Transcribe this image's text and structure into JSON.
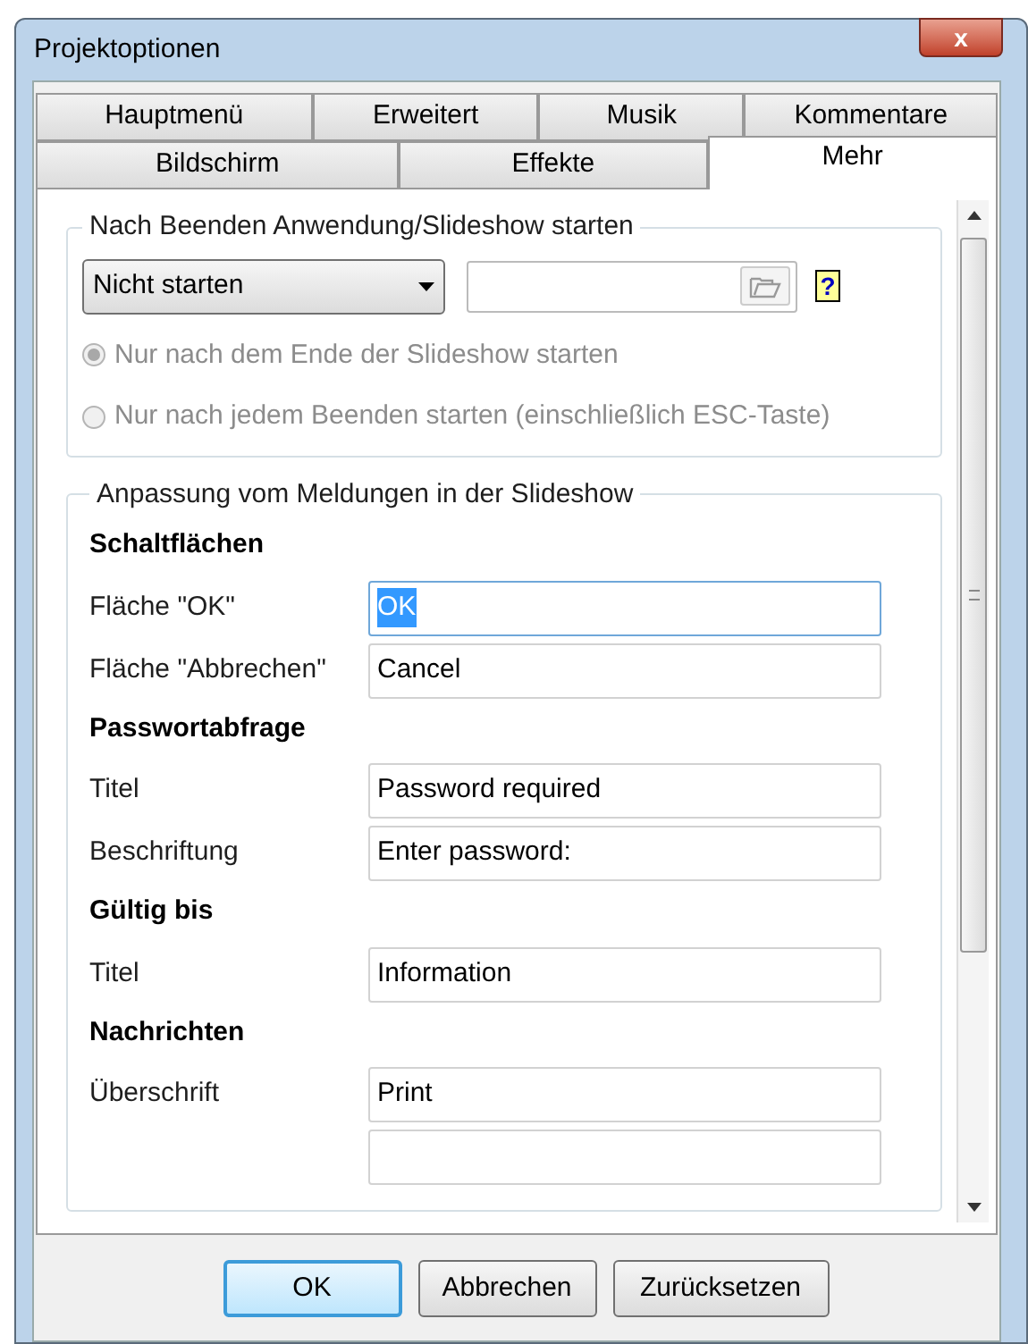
{
  "window": {
    "title": "Projektoptionen",
    "close_glyph": "x"
  },
  "tab_rows": [
    [
      {
        "label": "Hauptmenü",
        "selected": false
      },
      {
        "label": "Erweitert",
        "selected": false
      },
      {
        "label": "Musik",
        "selected": false
      },
      {
        "label": "Kommentare",
        "selected": false
      }
    ],
    [
      {
        "label": "Bildschirm",
        "selected": false
      },
      {
        "label": "Effekte",
        "selected": false
      },
      {
        "label": "Mehr",
        "selected": true
      }
    ]
  ],
  "start_group": {
    "title": "Nach Beenden Anwendung/Slideshow starten",
    "dropdown": {
      "value": "Nicht starten"
    },
    "help_glyph": "?",
    "radios": [
      {
        "label": "Nur nach dem Ende der Slideshow starten",
        "selected": true,
        "disabled": true
      },
      {
        "label": "Nur nach jedem Beenden starten (einschließlich ESC-Taste)",
        "selected": false,
        "disabled": true
      }
    ]
  },
  "messages_group": {
    "title": "Anpassung vom Meldungen in der Slideshow",
    "sections": [
      {
        "heading": "Schaltflächen",
        "fields": [
          {
            "label": "Fläche \"OK\"",
            "value": "OK",
            "focused": true
          },
          {
            "label": "Fläche \"Abbrechen\"",
            "value": "Cancel",
            "focused": false
          }
        ]
      },
      {
        "heading": "Passwortabfrage",
        "fields": [
          {
            "label": "Titel",
            "value": "Password required",
            "focused": false
          },
          {
            "label": "Beschriftung",
            "value": "Enter password:",
            "focused": false
          }
        ]
      },
      {
        "heading": "Gültig bis",
        "fields": [
          {
            "label": "Titel",
            "value": "Information",
            "focused": false
          }
        ]
      },
      {
        "heading": "Nachrichten",
        "fields": [
          {
            "label": "Überschrift",
            "value": "Print",
            "focused": false
          }
        ]
      }
    ]
  },
  "buttons": [
    {
      "label": "OK",
      "default": true
    },
    {
      "label": "Abbrechen",
      "default": false
    },
    {
      "label": "Zurücksetzen",
      "default": false
    }
  ]
}
